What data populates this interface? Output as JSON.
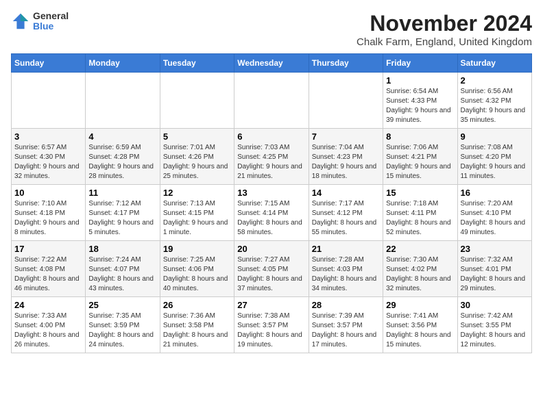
{
  "header": {
    "logo_general": "General",
    "logo_blue": "Blue",
    "month": "November 2024",
    "location": "Chalk Farm, England, United Kingdom"
  },
  "days_of_week": [
    "Sunday",
    "Monday",
    "Tuesday",
    "Wednesday",
    "Thursday",
    "Friday",
    "Saturday"
  ],
  "weeks": [
    [
      {
        "day": "",
        "info": ""
      },
      {
        "day": "",
        "info": ""
      },
      {
        "day": "",
        "info": ""
      },
      {
        "day": "",
        "info": ""
      },
      {
        "day": "",
        "info": ""
      },
      {
        "day": "1",
        "info": "Sunrise: 6:54 AM\nSunset: 4:33 PM\nDaylight: 9 hours and 39 minutes."
      },
      {
        "day": "2",
        "info": "Sunrise: 6:56 AM\nSunset: 4:32 PM\nDaylight: 9 hours and 35 minutes."
      }
    ],
    [
      {
        "day": "3",
        "info": "Sunrise: 6:57 AM\nSunset: 4:30 PM\nDaylight: 9 hours and 32 minutes."
      },
      {
        "day": "4",
        "info": "Sunrise: 6:59 AM\nSunset: 4:28 PM\nDaylight: 9 hours and 28 minutes."
      },
      {
        "day": "5",
        "info": "Sunrise: 7:01 AM\nSunset: 4:26 PM\nDaylight: 9 hours and 25 minutes."
      },
      {
        "day": "6",
        "info": "Sunrise: 7:03 AM\nSunset: 4:25 PM\nDaylight: 9 hours and 21 minutes."
      },
      {
        "day": "7",
        "info": "Sunrise: 7:04 AM\nSunset: 4:23 PM\nDaylight: 9 hours and 18 minutes."
      },
      {
        "day": "8",
        "info": "Sunrise: 7:06 AM\nSunset: 4:21 PM\nDaylight: 9 hours and 15 minutes."
      },
      {
        "day": "9",
        "info": "Sunrise: 7:08 AM\nSunset: 4:20 PM\nDaylight: 9 hours and 11 minutes."
      }
    ],
    [
      {
        "day": "10",
        "info": "Sunrise: 7:10 AM\nSunset: 4:18 PM\nDaylight: 9 hours and 8 minutes."
      },
      {
        "day": "11",
        "info": "Sunrise: 7:12 AM\nSunset: 4:17 PM\nDaylight: 9 hours and 5 minutes."
      },
      {
        "day": "12",
        "info": "Sunrise: 7:13 AM\nSunset: 4:15 PM\nDaylight: 9 hours and 1 minute."
      },
      {
        "day": "13",
        "info": "Sunrise: 7:15 AM\nSunset: 4:14 PM\nDaylight: 8 hours and 58 minutes."
      },
      {
        "day": "14",
        "info": "Sunrise: 7:17 AM\nSunset: 4:12 PM\nDaylight: 8 hours and 55 minutes."
      },
      {
        "day": "15",
        "info": "Sunrise: 7:18 AM\nSunset: 4:11 PM\nDaylight: 8 hours and 52 minutes."
      },
      {
        "day": "16",
        "info": "Sunrise: 7:20 AM\nSunset: 4:10 PM\nDaylight: 8 hours and 49 minutes."
      }
    ],
    [
      {
        "day": "17",
        "info": "Sunrise: 7:22 AM\nSunset: 4:08 PM\nDaylight: 8 hours and 46 minutes."
      },
      {
        "day": "18",
        "info": "Sunrise: 7:24 AM\nSunset: 4:07 PM\nDaylight: 8 hours and 43 minutes."
      },
      {
        "day": "19",
        "info": "Sunrise: 7:25 AM\nSunset: 4:06 PM\nDaylight: 8 hours and 40 minutes."
      },
      {
        "day": "20",
        "info": "Sunrise: 7:27 AM\nSunset: 4:05 PM\nDaylight: 8 hours and 37 minutes."
      },
      {
        "day": "21",
        "info": "Sunrise: 7:28 AM\nSunset: 4:03 PM\nDaylight: 8 hours and 34 minutes."
      },
      {
        "day": "22",
        "info": "Sunrise: 7:30 AM\nSunset: 4:02 PM\nDaylight: 8 hours and 32 minutes."
      },
      {
        "day": "23",
        "info": "Sunrise: 7:32 AM\nSunset: 4:01 PM\nDaylight: 8 hours and 29 minutes."
      }
    ],
    [
      {
        "day": "24",
        "info": "Sunrise: 7:33 AM\nSunset: 4:00 PM\nDaylight: 8 hours and 26 minutes."
      },
      {
        "day": "25",
        "info": "Sunrise: 7:35 AM\nSunset: 3:59 PM\nDaylight: 8 hours and 24 minutes."
      },
      {
        "day": "26",
        "info": "Sunrise: 7:36 AM\nSunset: 3:58 PM\nDaylight: 8 hours and 21 minutes."
      },
      {
        "day": "27",
        "info": "Sunrise: 7:38 AM\nSunset: 3:57 PM\nDaylight: 8 hours and 19 minutes."
      },
      {
        "day": "28",
        "info": "Sunrise: 7:39 AM\nSunset: 3:57 PM\nDaylight: 8 hours and 17 minutes."
      },
      {
        "day": "29",
        "info": "Sunrise: 7:41 AM\nSunset: 3:56 PM\nDaylight: 8 hours and 15 minutes."
      },
      {
        "day": "30",
        "info": "Sunrise: 7:42 AM\nSunset: 3:55 PM\nDaylight: 8 hours and 12 minutes."
      }
    ]
  ]
}
